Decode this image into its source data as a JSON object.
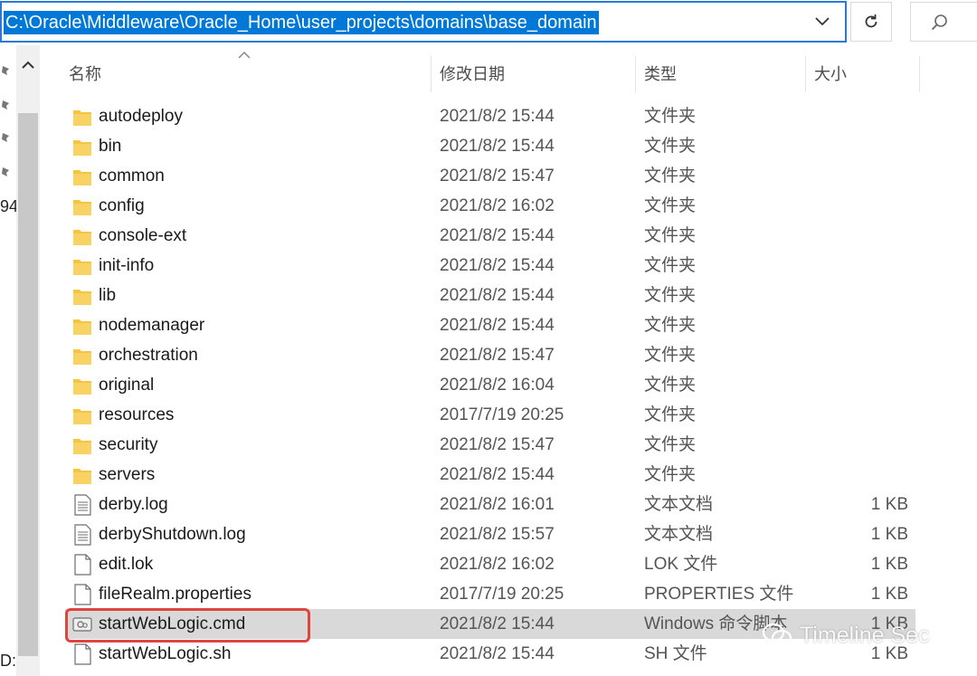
{
  "address": {
    "path": "C:\\Oracle\\Middleware\\Oracle_Home\\user_projects\\domains\\base_domain"
  },
  "nav": {
    "partial_labels": [
      "94",
      "D:"
    ]
  },
  "columns": {
    "name": "名称",
    "date": "修改日期",
    "type": "类型",
    "size": "大小"
  },
  "rows": [
    {
      "name": "autodeploy",
      "date": "2021/8/2 15:44",
      "type": "文件夹",
      "size": "",
      "icon": "folder-icon"
    },
    {
      "name": "bin",
      "date": "2021/8/2 15:44",
      "type": "文件夹",
      "size": "",
      "icon": "folder-icon"
    },
    {
      "name": "common",
      "date": "2021/8/2 15:47",
      "type": "文件夹",
      "size": "",
      "icon": "folder-icon"
    },
    {
      "name": "config",
      "date": "2021/8/2 16:02",
      "type": "文件夹",
      "size": "",
      "icon": "folder-icon"
    },
    {
      "name": "console-ext",
      "date": "2021/8/2 15:44",
      "type": "文件夹",
      "size": "",
      "icon": "folder-icon"
    },
    {
      "name": "init-info",
      "date": "2021/8/2 15:44",
      "type": "文件夹",
      "size": "",
      "icon": "folder-icon"
    },
    {
      "name": "lib",
      "date": "2021/8/2 15:44",
      "type": "文件夹",
      "size": "",
      "icon": "folder-icon"
    },
    {
      "name": "nodemanager",
      "date": "2021/8/2 15:44",
      "type": "文件夹",
      "size": "",
      "icon": "folder-icon"
    },
    {
      "name": "orchestration",
      "date": "2021/8/2 15:47",
      "type": "文件夹",
      "size": "",
      "icon": "folder-icon"
    },
    {
      "name": "original",
      "date": "2021/8/2 16:04",
      "type": "文件夹",
      "size": "",
      "icon": "folder-icon"
    },
    {
      "name": "resources",
      "date": "2017/7/19 20:25",
      "type": "文件夹",
      "size": "",
      "icon": "folder-icon"
    },
    {
      "name": "security",
      "date": "2021/8/2 15:47",
      "type": "文件夹",
      "size": "",
      "icon": "folder-icon"
    },
    {
      "name": "servers",
      "date": "2021/8/2 15:44",
      "type": "文件夹",
      "size": "",
      "icon": "folder-icon"
    },
    {
      "name": "derby.log",
      "date": "2021/8/2 16:01",
      "type": "文本文档",
      "size": "1 KB",
      "icon": "text-file-icon"
    },
    {
      "name": "derbyShutdown.log",
      "date": "2021/8/2 15:57",
      "type": "文本文档",
      "size": "1 KB",
      "icon": "text-file-icon"
    },
    {
      "name": "edit.lok",
      "date": "2021/8/2 16:02",
      "type": "LOK 文件",
      "size": "1 KB",
      "icon": "blank-file-icon"
    },
    {
      "name": "fileRealm.properties",
      "date": "2017/7/19 20:25",
      "type": "PROPERTIES 文件",
      "size": "1 KB",
      "icon": "blank-file-icon"
    },
    {
      "name": "startWebLogic.cmd",
      "date": "2021/8/2 15:44",
      "type": "Windows 命令脚本",
      "size": "1 KB",
      "icon": "cmd-file-icon",
      "selected": true
    },
    {
      "name": "startWebLogic.sh",
      "date": "2021/8/2 15:44",
      "type": "SH 文件",
      "size": "1 KB",
      "icon": "blank-file-icon"
    }
  ],
  "watermark": {
    "text": "Timeline Sec"
  },
  "colors": {
    "accent": "#0078d7",
    "folder": "#f5c542",
    "highlight": "#e0443e",
    "selected_row": "#d9d9d9"
  }
}
